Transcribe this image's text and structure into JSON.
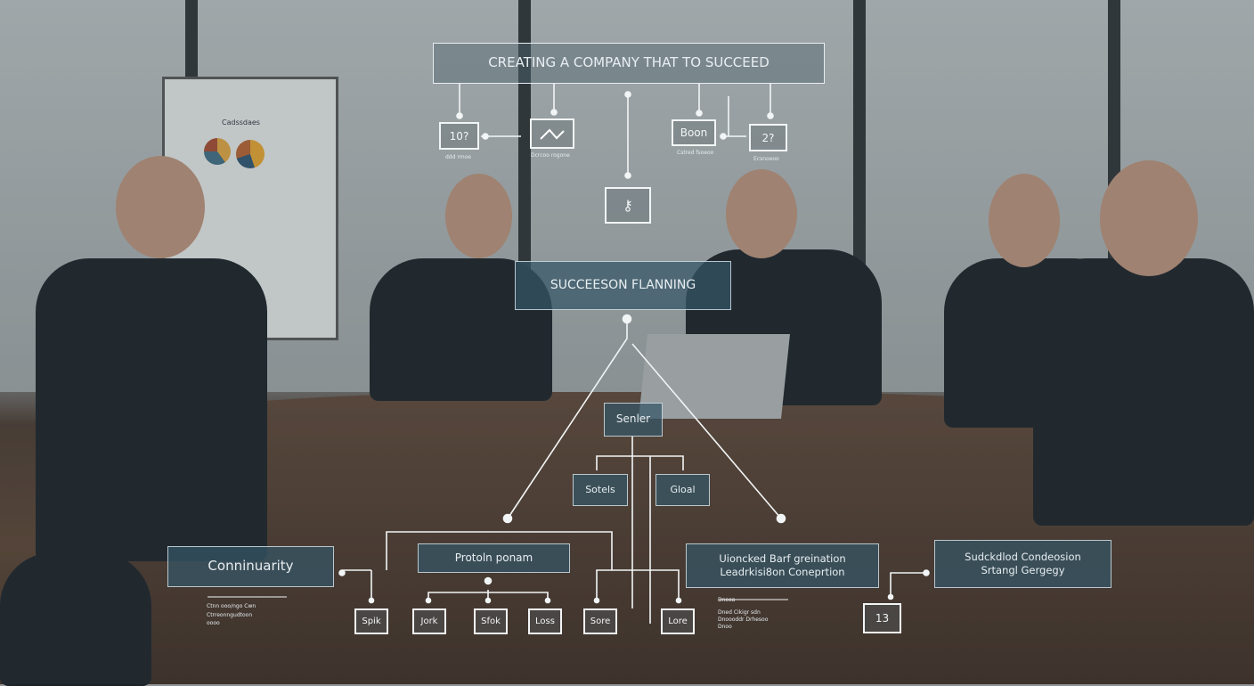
{
  "diagram": {
    "title": "CREATING A COMPANY THAT TO SUCCEED",
    "center": "SUCCEESON FLANNING",
    "top_nodes": [
      {
        "label": "10?",
        "caption": "ddd rmoe"
      },
      {
        "label": "",
        "icon": "chart-line-icon",
        "caption": "Dcrcoo rogone"
      },
      {
        "label": "Boon",
        "caption": "Cstred fsoeoo"
      },
      {
        "label": "2?",
        "caption": "Ecsnoeoo"
      }
    ],
    "key_node_icon": "key-icon",
    "senior": "Senler",
    "sub_nodes": [
      "Sotels",
      "Gloal"
    ],
    "community": "Conninuarity",
    "community_notes": [
      "Ctnn ooo/ngo Cwn",
      "Ctrreonngudtoon",
      "oooo"
    ],
    "program": "Protoln ponam",
    "leaf_nodes": [
      "Spik",
      "Jork",
      "Sfok",
      "Loss",
      "Sore",
      "Lore"
    ],
    "unlocked": [
      "Uioncked Barf greination",
      "Leadrkisi8on Coneprtion"
    ],
    "unlocked_notes": [
      "Dnooa",
      "Dned Cikigr sdn",
      "Dnoooddr Drhesoo",
      "Dnoo"
    ],
    "succession": [
      "Sudckdlod Condeosion",
      "Srtangl Gergegy"
    ],
    "number_node": "13",
    "flipchart": {
      "title": "Cadssdaes"
    }
  }
}
